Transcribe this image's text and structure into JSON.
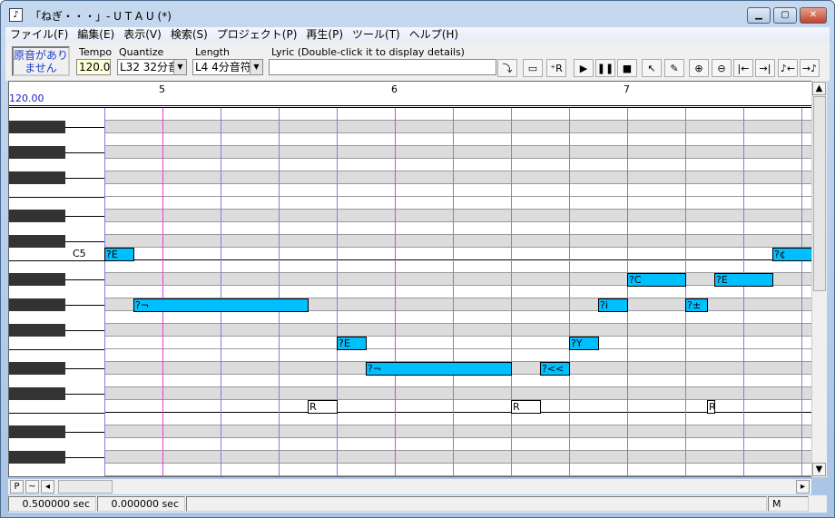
{
  "window": {
    "title": "「ねぎ・・・」- U T A U (*)",
    "app_icon": "music-note-icon",
    "controls": [
      "minimize",
      "maximize",
      "close"
    ]
  },
  "menu": [
    "ファイル(F)",
    "編集(E)",
    "表示(V)",
    "検索(S)",
    "プロジェクト(P)",
    "再生(P)",
    "ツール(T)",
    "ヘルプ(H)"
  ],
  "toolbar": {
    "voice_status": "原音がありません",
    "tempo_label": "Tempo",
    "tempo_value": "120.0",
    "quantize_label": "Quantize",
    "quantize_value": "L32 32分音",
    "length_label": "Length",
    "length_value": "L4  4分音符",
    "lyric_label": "Lyric (Double-click it to display details)",
    "lyric_value": "",
    "buttons": [
      {
        "name": "insert-icon",
        "glyph": "⤵"
      },
      {
        "name": "add-note-icon",
        "glyph": "▭"
      },
      {
        "name": "add-rest-icon",
        "glyph": "⁺R"
      },
      {
        "name": "play-icon",
        "glyph": "▶"
      },
      {
        "name": "pause-icon",
        "glyph": "❚❚"
      },
      {
        "name": "stop-icon",
        "glyph": "■"
      },
      {
        "name": "select-cursor-icon",
        "glyph": "↖"
      },
      {
        "name": "pencil-icon",
        "glyph": "✎"
      },
      {
        "name": "zoom-in-icon",
        "glyph": "⊕"
      },
      {
        "name": "zoom-out-icon",
        "glyph": "⊖"
      },
      {
        "name": "go-start-icon",
        "glyph": "|←"
      },
      {
        "name": "go-end-icon",
        "glyph": "→|"
      },
      {
        "name": "note-left-icon",
        "glyph": "♪←"
      },
      {
        "name": "note-right-icon",
        "glyph": "→♪"
      }
    ]
  },
  "ruler": {
    "tempo": "120.00",
    "measures": [
      "5",
      "6",
      "7"
    ]
  },
  "piano": {
    "label": "C5"
  },
  "notes": [
    {
      "lyric": "?E",
      "pitch": "C5",
      "start_tick": 7200,
      "length": 240
    },
    {
      "lyric": "?¬",
      "pitch": "G#4",
      "start_tick": 7440,
      "length": 1440
    },
    {
      "lyric": "R",
      "pitch": "C4",
      "start_tick": 8880,
      "length": 240,
      "rest": true
    },
    {
      "lyric": "?E",
      "pitch": "F4",
      "start_tick": 9120,
      "length": 240
    },
    {
      "lyric": "?¬",
      "pitch": "D#4",
      "start_tick": 9360,
      "length": 1200
    },
    {
      "lyric": "R",
      "pitch": "C4",
      "start_tick": 10560,
      "length": 240,
      "rest": true
    },
    {
      "lyric": "?<<",
      "pitch": "D#4",
      "start_tick": 10800,
      "length": 240
    },
    {
      "lyric": "?Y",
      "pitch": "F4",
      "start_tick": 11040,
      "length": 240
    },
    {
      "lyric": "?i",
      "pitch": "G#4",
      "start_tick": 11280,
      "length": 240
    },
    {
      "lyric": "?C",
      "pitch": "A#4",
      "start_tick": 11520,
      "length": 480
    },
    {
      "lyric": "?±",
      "pitch": "G#4",
      "start_tick": 12000,
      "length": 180
    },
    {
      "lyric": "R",
      "pitch": "C4",
      "start_tick": 12180,
      "length": 60,
      "rest": true
    },
    {
      "lyric": "?E",
      "pitch": "A#4",
      "start_tick": 12240,
      "length": 480
    },
    {
      "lyric": "?¢",
      "pitch": "C5",
      "start_tick": 12720,
      "length": 480
    }
  ],
  "scroll": {
    "p_label": "P",
    "pitch_label": "~"
  },
  "status": {
    "time1": "0.500000 sec",
    "time2": "0.000000 sec",
    "mode": "M"
  },
  "colors": {
    "note": "#00bfff",
    "measure_line": "#e040e0",
    "beat_line": "#8080e0",
    "black_row": "#dcdcdc"
  }
}
